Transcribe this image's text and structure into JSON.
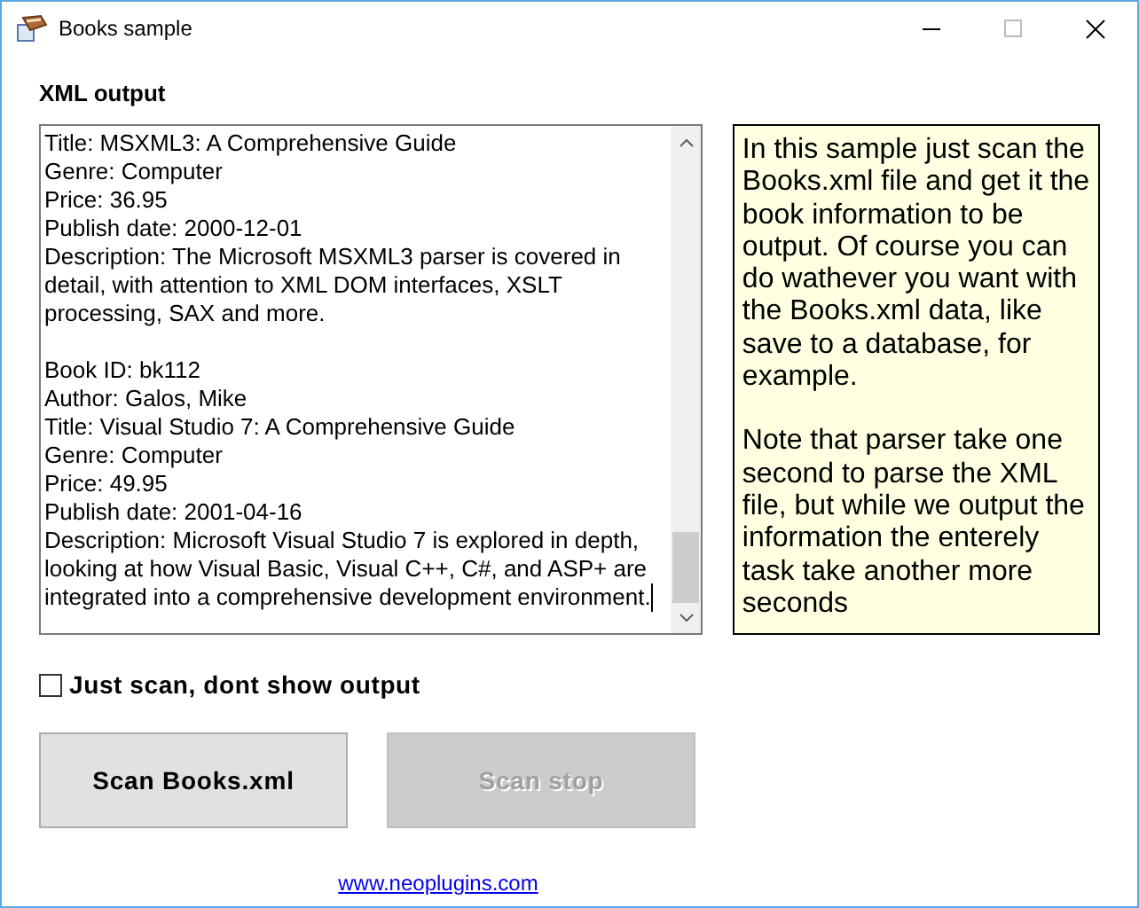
{
  "window": {
    "title": "Books sample"
  },
  "output": {
    "label": "XML output",
    "blocks": [
      [
        "Title: MSXML3: A Comprehensive Guide",
        "Genre: Computer",
        "Price: 36.95",
        "Publish date: 2000-12-01",
        "Description: The Microsoft MSXML3 parser is covered in",
        "detail, with attention to XML DOM interfaces, XSLT",
        "processing, SAX and more."
      ],
      [
        "Book ID: bk112",
        "Author: Galos, Mike",
        "Title: Visual Studio 7: A Comprehensive Guide",
        "Genre: Computer",
        "Price: 49.95",
        "Publish date: 2001-04-16",
        "Description: Microsoft Visual Studio 7 is explored in depth,",
        "looking at how Visual Basic, Visual C++, C#, and ASP+ are",
        "integrated into a comprehensive development environment."
      ]
    ]
  },
  "info": [
    "In this sample just scan the Books.xml file and get it the book information to be output. Of course you can do wathever you want with the Books.xml data, like save to a database, for example.",
    "Note that parser take one second to parse the XML file, but while we output the information the enterely task take another more seconds"
  ],
  "checkbox": {
    "label": "Just scan, dont show output",
    "checked": false
  },
  "buttons": [
    {
      "label": "Scan Books.xml",
      "disabled": false
    },
    {
      "label": "Scan stop",
      "disabled": true
    }
  ],
  "link": "www.neoplugins.com"
}
